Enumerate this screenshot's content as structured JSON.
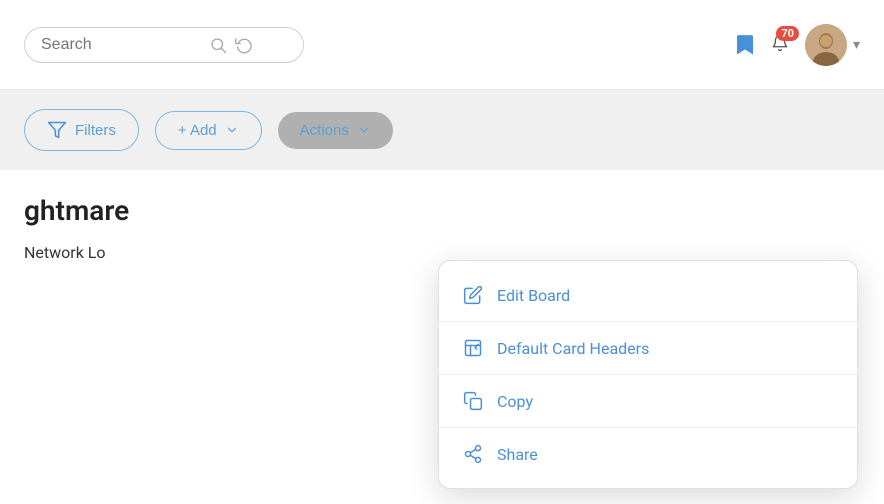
{
  "header": {
    "search": {
      "placeholder": "Search",
      "value": ""
    },
    "notification_count": "70",
    "chevron": "▾"
  },
  "toolbar": {
    "filters_label": "Filters",
    "add_label": "+ Add",
    "actions_label": "Actions"
  },
  "main": {
    "title": "ghtmare",
    "network_label": "Network Lo"
  },
  "dropdown": {
    "items": [
      {
        "id": "edit-board",
        "label": "Edit Board",
        "icon": "edit"
      },
      {
        "id": "default-card-headers",
        "label": "Default Card Headers",
        "icon": "edit-card"
      },
      {
        "id": "copy",
        "label": "Copy",
        "icon": "copy"
      },
      {
        "id": "share",
        "label": "Share",
        "icon": "share"
      }
    ]
  },
  "colors": {
    "accent": "#4a90d9",
    "badge_bg": "#e74c3c",
    "actions_bg": "#b0b0b0"
  }
}
